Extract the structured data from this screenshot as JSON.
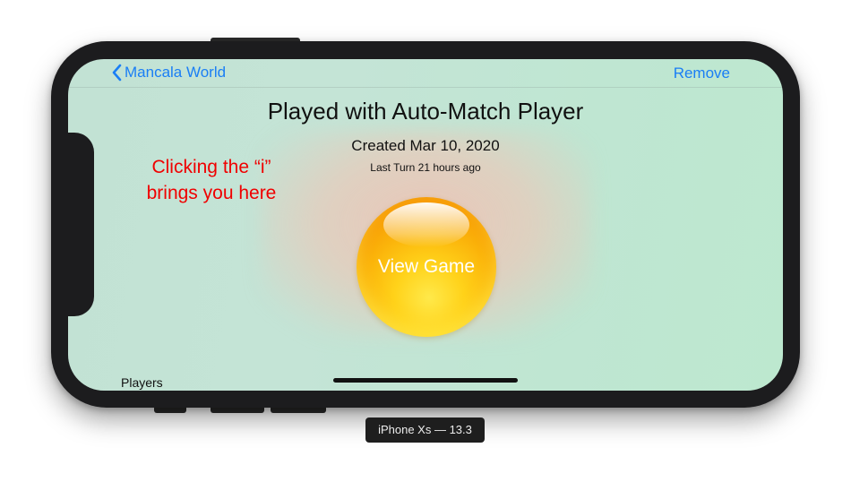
{
  "navbar": {
    "back_label": "Mancala World",
    "back_icon": "chevron-left-icon",
    "remove_label": "Remove",
    "accent_color": "#1a7ef5"
  },
  "game": {
    "title": "Played with Auto-Match Player",
    "created": "Created Mar 10, 2020",
    "last_turn": "Last Turn 21 hours ago",
    "view_button_label": "View Game"
  },
  "annotation": {
    "line1": "Clicking the “i”",
    "line2": "brings you here",
    "color": "#f00000"
  },
  "section": {
    "players_label": "Players"
  },
  "device": {
    "label": "iPhone Xs — 13.3"
  }
}
